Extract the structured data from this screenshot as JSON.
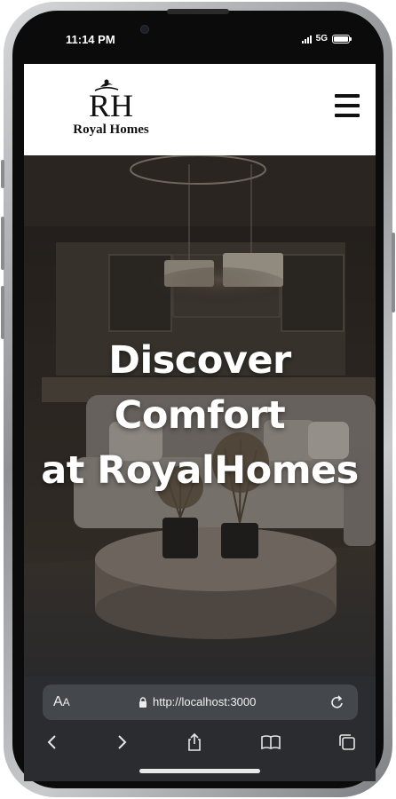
{
  "status_bar": {
    "time": "11:14 PM",
    "network": "5G"
  },
  "site": {
    "logo_monogram": "RH",
    "brand_name": "Royal Homes",
    "menu_icon": "hamburger-icon",
    "hero_title_line1": "Discover Comfort",
    "hero_title_line2": "at RoyalHomes"
  },
  "browser": {
    "text_size_label_big": "A",
    "text_size_label_small": "A",
    "url": "http://localhost:3000",
    "icons": [
      "lock-icon",
      "reload-icon",
      "back-icon",
      "forward-icon",
      "share-icon",
      "bookmarks-icon",
      "tabs-icon"
    ]
  },
  "colors": {
    "header_bg": "#ffffff",
    "hero_overlay": "#3a332d",
    "browser_bg": "#2a2c2f",
    "url_bar_bg": "#44474b"
  }
}
